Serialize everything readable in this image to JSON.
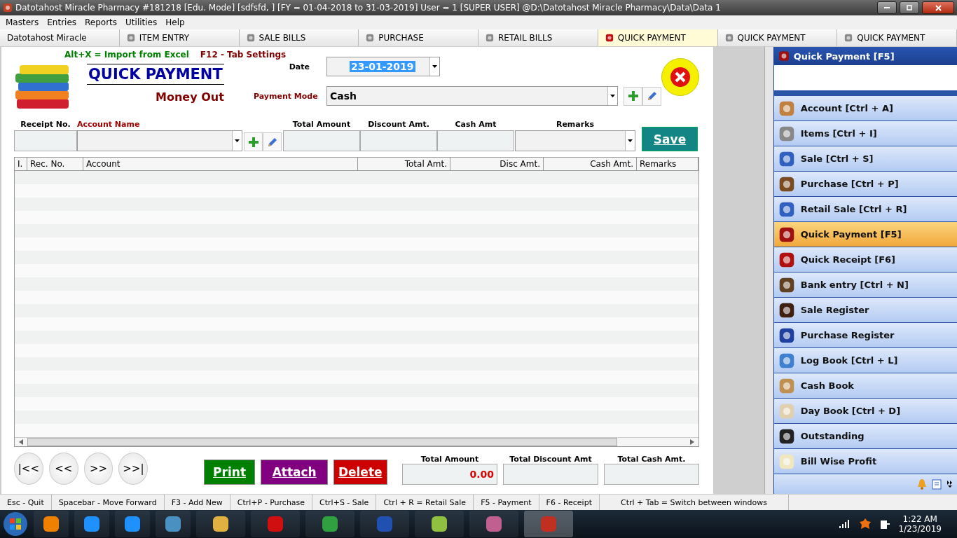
{
  "window": {
    "title": "Datotahost Miracle Pharmacy #181218  [Edu. Mode]  [sdfsfd, ]  [FY = 01-04-2018 to 31-03-2019]  User = 1 [SUPER USER]  @D:\\Datotahost Miracle Pharmacy\\Data\\Data 1"
  },
  "menu": [
    "Masters",
    "Entries",
    "Reports",
    "Utilities",
    "Help"
  ],
  "tabs": [
    {
      "label": "Datotahost Miracle",
      "selected": false
    },
    {
      "label": "ITEM ENTRY",
      "selected": false
    },
    {
      "label": "SALE BILLS",
      "selected": false
    },
    {
      "label": "PURCHASE",
      "selected": false
    },
    {
      "label": "RETAIL BILLS",
      "selected": false
    },
    {
      "label": "QUICK PAYMENT",
      "selected": true
    },
    {
      "label": "QUICK PAYMENT",
      "selected": false
    },
    {
      "label": "QUICK PAYMENT",
      "selected": false
    }
  ],
  "form": {
    "hint_import": "Alt+X =  Import from Excel",
    "hint_tabs": "F12 - Tab Settings",
    "title": "QUICK PAYMENT",
    "subtitle": "Money Out",
    "date_label": "Date",
    "date_value": "23-01-2019",
    "payment_mode_label": "Payment Mode",
    "payment_mode_value": "Cash",
    "entry_labels": [
      "Receipt No.",
      "Account Name",
      "Total Amount",
      "Discount Amt.",
      "Cash Amt",
      "Remarks"
    ],
    "save": "Save"
  },
  "table": {
    "columns": [
      "I.",
      "Rec. No.",
      "Account",
      "Total Amt.",
      "Disc Amt.",
      "Cash Amt.",
      "Remarks"
    ]
  },
  "nav_buttons": [
    "|<<",
    "<<",
    ">>",
    ">>|"
  ],
  "action_buttons": [
    {
      "label": "Print",
      "color": "#008000"
    },
    {
      "label": "Attach",
      "color": "#800080"
    },
    {
      "label": "Delete",
      "color": "#cc0000"
    }
  ],
  "totals": [
    {
      "label": "Total Amount",
      "value": "0.00"
    },
    {
      "label": "Total Discount Amt"
    },
    {
      "label": "Total Cash Amt."
    }
  ],
  "sidebar": {
    "header": "Quick Payment [F5]",
    "items": [
      {
        "label": "Account [Ctrl + A]",
        "selected": false
      },
      {
        "label": "Items [Ctrl + I]",
        "selected": false
      },
      {
        "label": "Sale [Ctrl + S]",
        "selected": false
      },
      {
        "label": "Purchase [Ctrl + P]",
        "selected": false
      },
      {
        "label": "Retail Sale [Ctrl + R]",
        "selected": false
      },
      {
        "label": "Quick Payment [F5]",
        "selected": true
      },
      {
        "label": "Quick Receipt [F6]",
        "selected": false
      },
      {
        "label": "Bank entry [Ctrl + N]",
        "selected": false
      },
      {
        "label": "Sale Register",
        "selected": false
      },
      {
        "label": "Purchase Register",
        "selected": false
      },
      {
        "label": "Log Book [Ctrl + L]",
        "selected": false
      },
      {
        "label": "Cash Book",
        "selected": false
      },
      {
        "label": "Day Book [Ctrl + D]",
        "selected": false
      },
      {
        "label": "Outstanding",
        "selected": false
      },
      {
        "label": "Bill Wise Profit",
        "selected": false
      }
    ]
  },
  "status_bar": [
    "Esc - Quit",
    "Spacebar - Move Forward",
    "F3 - Add New",
    "Ctrl+P - Purchase",
    "Ctrl+S - Sale",
    "Ctrl + R = Retail Sale",
    "F5 - Payment",
    "F6 - Receipt",
    "Ctrl + Tab = Switch between windows"
  ],
  "taskbar": {
    "time": "1:22 AM",
    "date": "1/23/2019"
  }
}
